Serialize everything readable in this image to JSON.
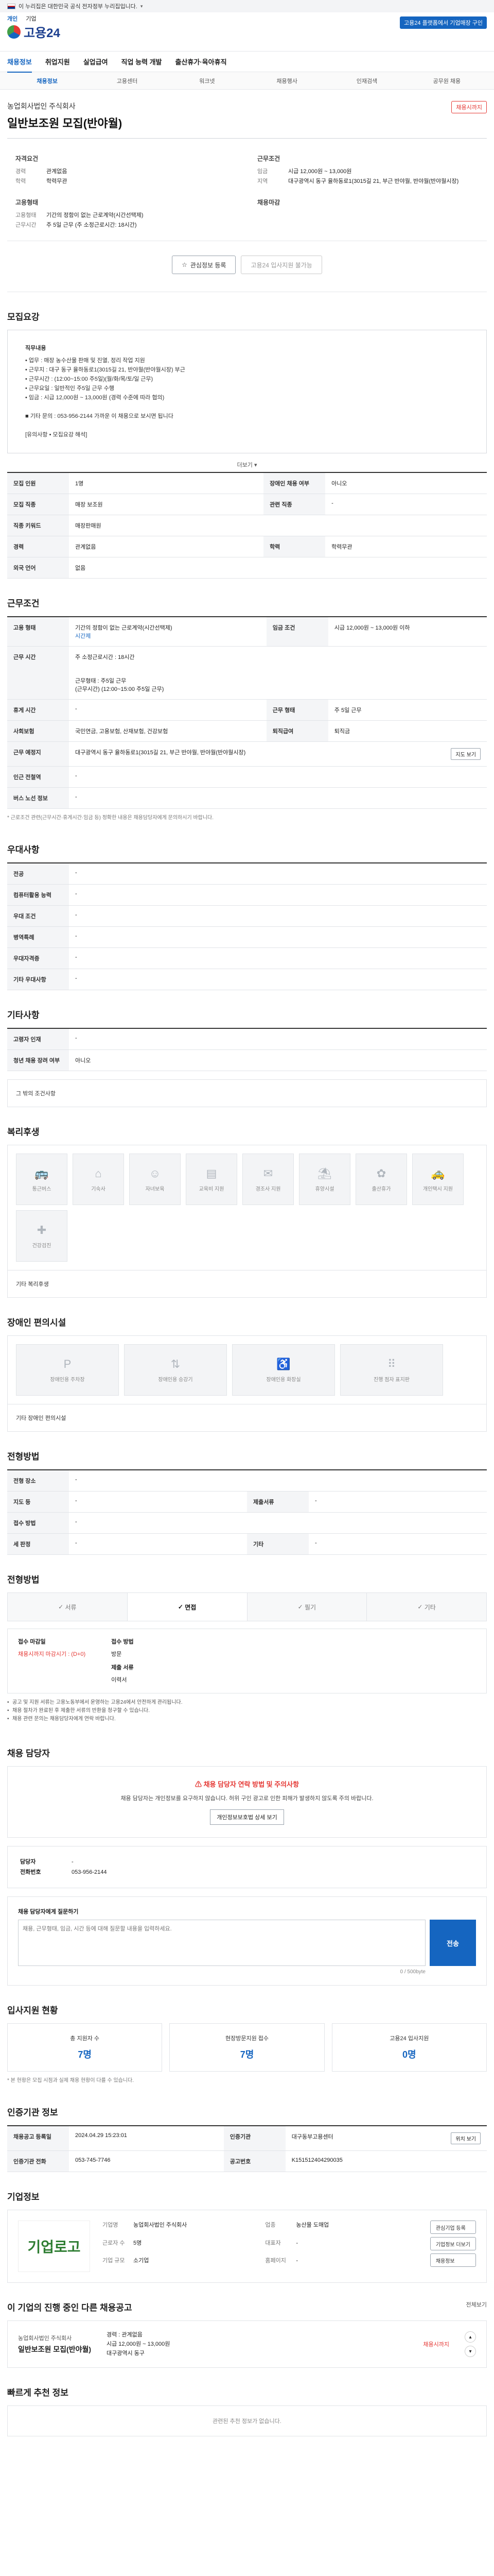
{
  "gov_banner": {
    "text": "이 누리집은 대한민국 공식 전자정부 누리집입니다."
  },
  "header": {
    "lang_tabs": [
      "개인",
      "기업"
    ],
    "logo": "고용24",
    "employ_btn": "고용24 플랫폼에서 기업매장 구인",
    "gnb": [
      "채용정보",
      "취업지원",
      "실업급여",
      "직업 능력 개발",
      "출산휴가·육아휴직"
    ],
    "subnav": [
      "채용정보",
      "고용센터",
      "워크넷",
      "채용행사",
      "인재검색",
      "공무원 채용"
    ]
  },
  "job": {
    "company": "농업회사법인 주식회사",
    "title": "일반보조원 모집(반야월)",
    "status": "채용시까지",
    "summary": {
      "left_heading_1": "자격요건",
      "career_label": "경력",
      "career": "관계없음",
      "edu_label": "학력",
      "edu": "학력무관",
      "left_heading_2": "고용형태",
      "type_label": "고용형태",
      "type": "기간의 정함이 없는 근로계약(시간선택제)",
      "worktime_label": "근무시간",
      "worktime": "주 5일 근무 (주 소정근로시간: 18시간)",
      "right_heading_1": "근무조건",
      "wage_label": "임금",
      "wage": "시급 12,000원 ~ 13,000원",
      "region_label": "지역",
      "region": "대구광역시 동구 율하동로1(3015길 21, 부근 반야월, 반야월(반야월시장)",
      "right_heading_2": "채용마감"
    },
    "btn_interest": "관심정보 등록",
    "btn_apply": "고용24 입사지원 불가능"
  },
  "recruit": {
    "title": "모집요강",
    "notice_lines": [
      "직무내용",
      "• 업무 : 매장 농수산물 판매 및 진열, 정리 작업 지원",
      "• 근무지 : 대구 동구 율하동로1(3015길 21, 반야월(반야월시장) 부근",
      "• 근무시간 : (12:00~15:00 주5일)(월/화/목/토/일 근무)",
      "• 근무요일 : 일반적인 주5일 근무 수행",
      "• 임금 : 시급 12,000원 ~ 13,000원 (경력 수준에 따라 협의)",
      "",
      "■ 기타 문의 : 053-956-2144 가까운 이 채용으로 보시면 됩니다",
      "",
      "[유의사항 • 모집요강 해석]"
    ],
    "more": "더보기",
    "rows": [
      {
        "k": "모집 인원",
        "v": "1명",
        "k2": "장애인 채용 여부",
        "v2": "아니오"
      },
      {
        "k": "모집 직종",
        "v": "매장 보조원",
        "k2": "관련 직종",
        "v2": "-"
      },
      {
        "k": "직종 키워드",
        "v": "매장판매원",
        "k2": "",
        "v2": ""
      },
      {
        "k": "경력",
        "v": "관계없음",
        "k2": "학력",
        "v2": "학력무관"
      },
      {
        "k": "외국 언어",
        "v": "없음",
        "k2": "",
        "v2": ""
      }
    ]
  },
  "conditions": {
    "title": "근무조건",
    "emp_type_label": "고용 형태",
    "emp_type": "기간의 정함이 없는 근로계약(시간선택제)",
    "emp_type_sub": "시간제",
    "wage_label": "임금 조건",
    "wage": "시급 12,000원 ~ 13,000원 이하",
    "worktime_label": "근무 시간",
    "worktime_lines": [
      "주 소정근로시간 : 18시간",
      "근무형태 : 주5일 근무",
      "(근무시간) (12:00~15:00 주5일 근무)"
    ],
    "rows": [
      {
        "k": "휴게 시간",
        "v": "-",
        "k2": "근무 형태",
        "v2": "주 5일 근무"
      },
      {
        "k": "사회보험",
        "v": "국민연금, 고용보험, 산재보험, 건강보험",
        "k2": "퇴직급여",
        "v2": "퇴직금"
      },
      {
        "k": "근무 예정지",
        "v": "대구광역시 동구 율하동로1(3015길 21, 부근 반야월, 반야월(반야월시장)",
        "k2": "",
        "v2": ""
      },
      {
        "k": "인근 전철역",
        "v": "-",
        "k2": "",
        "v2": ""
      },
      {
        "k": "버스 노선 정보",
        "v": "-",
        "k2": "",
        "v2": ""
      }
    ],
    "map_btn": "지도 보기",
    "note": "* 근로조건 관련(근무시간·휴게시간·임금 등) 정확한 내용은 채용담당자에게 문의하시기 바랍니다."
  },
  "prefs": {
    "title": "우대사항",
    "rows": [
      {
        "k": "전공",
        "v": "-"
      },
      {
        "k": "컴퓨터활용 능력",
        "v": "-"
      },
      {
        "k": "우대 조건",
        "v": "-"
      },
      {
        "k": "병역특례",
        "v": "-"
      },
      {
        "k": "우대자격증",
        "v": "-"
      },
      {
        "k": "기타 우대사항",
        "v": "-"
      }
    ]
  },
  "etc": {
    "title": "기타사항",
    "rows": [
      {
        "k": "고령자 인재",
        "v": "-"
      },
      {
        "k": "청년 채용 장려 여부",
        "v": "아니오"
      }
    ],
    "sub_label": "그 밖의 조건사항"
  },
  "welfare": {
    "title": "복리후생",
    "tiles": [
      "통근버스",
      "기숙사",
      "자녀보육",
      "교육비 지원",
      "경조사 지원",
      "휴양시설",
      "출산휴가",
      "개인택시 지원",
      "건강검진"
    ],
    "sub_label": "기타 복리후생"
  },
  "disability": {
    "title": "장애인 편의시설",
    "tiles": [
      "장애인용 주차장",
      "장애인용 승강기",
      "장애인용 화장실",
      "진행 점자 표지판"
    ],
    "sub_label": "기타 장애인 편의시설"
  },
  "process": {
    "title": "전형방법",
    "rows": [
      {
        "k": "전형 장소",
        "v": "-",
        "k2": "",
        "v2": ""
      },
      {
        "k": "지도 등",
        "v": "-",
        "k2": "제출서류",
        "v2": "-"
      },
      {
        "k": "접수 방법",
        "v": "-",
        "k2": "",
        "v2": ""
      },
      {
        "k": "세 판정",
        "v": "-",
        "k2": "기타",
        "v2": "-"
      }
    ]
  },
  "method": {
    "title": "전형방법",
    "steps": [
      "서류",
      "면접",
      "필기",
      "기타"
    ],
    "deadline_label": "접수 마감일",
    "deadline": "채용시까지 마감시기 : (D+0)",
    "apply_label": "접수 방법",
    "apply": "방문",
    "docs_label": "제출 서류",
    "docs": "이력서",
    "bullets": [
      "공고 및 지원 서류는 고용노동부에서 운영하는 고용24에서 안전하게 관리됩니다.",
      "채용 절차가 완료된 후 제출한 서류의 반환을 청구할 수 있습니다.",
      "채용 관련 문의는 채용담당자에게 연락 바랍니다."
    ]
  },
  "contact": {
    "title": "채용 담당자",
    "alert_title": "채용 담당자 연락 방법 및 주의사항",
    "alert_text": "채용 담당자는 개인정보를 요구하지 않습니다. 허위 구인 광고로 인한 피해가 발생하지 않도록 주의 바랍니다.",
    "alert_btn": "개인정보보호법 상세 보기",
    "person_label": "담당자",
    "person": "-",
    "phone_label": "전화번호",
    "phone": "053-956-2144",
    "inquiry_label": "채용 담당자에게 질문하기",
    "inquiry_placeholder": "채용, 근무형태, 임금, 시간 등에 대해 질문할 내용을 입력하세요.",
    "inquiry_btn": "전송",
    "counter": "0 / 500byte"
  },
  "status": {
    "title": "입사지원 현황",
    "stats": [
      {
        "label": "총 지원자 수",
        "num": "7명"
      },
      {
        "label": "현장방문지원 접수",
        "num": "7명"
      },
      {
        "label": "고용24 입사지원",
        "num": "0명"
      }
    ],
    "note": "* 본 현황은 모집 시점과 실제 채용 현황이 다를 수 있습니다."
  },
  "reg": {
    "title": "인증기관 정보",
    "rows": [
      {
        "k": "채용공고 등록일",
        "v": "2024.04.29 15:23:01",
        "k2": "인증기관",
        "v2": "대구동부고용센터"
      },
      {
        "k": "인증기관 전화",
        "v": "053-745-7746",
        "k2": "공고번호",
        "v2": "K151512404290035"
      }
    ],
    "view_btn": "위치 보기"
  },
  "company": {
    "title": "기업정보",
    "logo_text": "기업로고",
    "fields": [
      {
        "k": "기업명",
        "v": "농업회사법인 주식회사"
      },
      {
        "k": "업종",
        "v": "농산물 도매업"
      },
      {
        "k": "근로자 수",
        "v": "5명"
      },
      {
        "k": "대표자",
        "v": "-"
      },
      {
        "k": "기업 규모",
        "v": "소기업"
      },
      {
        "k": "홈페이지",
        "v": "-"
      }
    ],
    "btns": [
      "관심기업 등록",
      "기업정보 더보기",
      "채용정보"
    ]
  },
  "other": {
    "title": "이 기업의 진행 중인 다른 채용공고",
    "company": "농업회사법인 주식회사",
    "job_title": "일반보조원 모집(반야월)",
    "career": "경력 : 관계없음",
    "wage": "시급 12,000원 ~ 13,000원",
    "region": "대구광역시 동구",
    "deadline": "채용시까지",
    "more": "전체보기"
  },
  "recommend": {
    "title": "빠르게 추천 정보",
    "empty": "관련된 추천 정보가 없습니다."
  }
}
